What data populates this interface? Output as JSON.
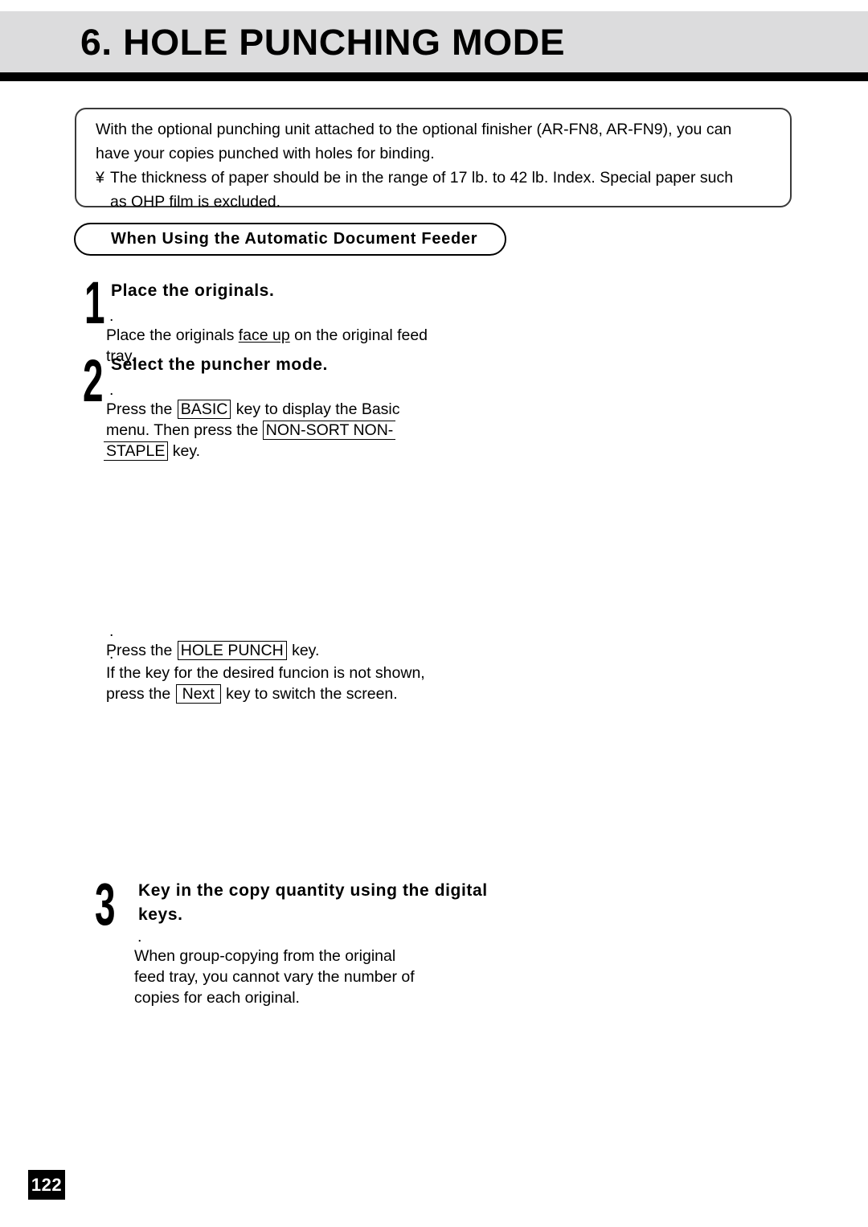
{
  "header": {
    "title": "6. HOLE PUNCHING MODE"
  },
  "intro": {
    "line1": "With the optional punching unit attached to the optional finisher (AR-FN8, AR-FN9), you can",
    "line2": "have your copies punched with holes for binding.",
    "note_marker": "¥",
    "note_line1": "The thickness of paper should be in the range of 17 lb. to 42 lb. Index. Special paper such",
    "note_line2": "as OHP film is excluded."
  },
  "section": {
    "pill_label": "When Using the Automatic Document Feeder"
  },
  "steps": [
    {
      "number": "1",
      "title": "Place the originals.",
      "bullet": ".",
      "body_pre": "Place the originals ",
      "body_underlined": "face up",
      "body_post": " on the original feed",
      "body_line2": "tray."
    },
    {
      "number": "2",
      "title": "Select the puncher mode.",
      "bullet": ".",
      "line1_pre": "Press  the ",
      "key_basic": "BASIC",
      "line1_post": " key  to  display  the  Basic",
      "line2_pre": "menu.  Then  press  the ",
      "key_nonsort": "NON-SORT NON-",
      "key_staple": "STAPLE",
      "line3_post": " key."
    }
  ],
  "mid_bullets": {
    "b1_bullet": ".",
    "b1_pre": "Press  the ",
    "b1_key": "HOLE PUNCH",
    "b1_post": " key.",
    "b2_bullet": ".",
    "b2_line1": "If the key for the desired funcion is not shown,",
    "b2_line2_pre": "press  the ",
    "b2_key": "Next",
    "b2_line2_post": " key  to  switch  the  screen."
  },
  "step3": {
    "number": "3",
    "title_line1": "Key in the copy quantity using the digital",
    "title_line2": "keys.",
    "bullet": ".",
    "body_line1": "When  group-copying  from  the  original",
    "body_line2": "feed tray, you cannot vary the number of",
    "body_line3": "copies  for  each  original."
  },
  "footer": {
    "page_number": "122"
  },
  "colors": {
    "header_band": "#dcdcdd",
    "rule": "#000000",
    "text": "#000000",
    "box_border": "#3a3a3a"
  }
}
